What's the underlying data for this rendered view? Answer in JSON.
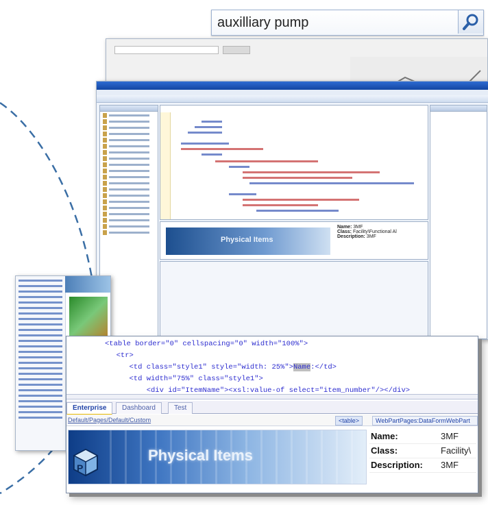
{
  "search": {
    "query": "auxilliary pump",
    "icon": "search-icon"
  },
  "front_screenshot": {
    "code_lines": [
      "<table border=\"0\" cellspacing=\"0\" width=\"100%\">",
      "  <tr>",
      "     <td class=\"style1\" style=\"width: 25%\">Name:</td>",
      "     <td width=\"75%\" class=\"style1\">",
      "         <div id=\"ItemName\"><xsl:value-of select=\"item_number\"/></div>"
    ],
    "tabs": [
      "Enterprise",
      "Dashboard",
      "Test"
    ],
    "breadcrumb": "Default/Pages/Default/Custom",
    "breadcrumb_tag": "<table>",
    "breadcrumb_right": "WebPartPages:DataFormWebPart",
    "banner_title": "Physical Items",
    "banner_icon_letter": "P",
    "properties": [
      {
        "label": "Name:",
        "value": "3MF"
      },
      {
        "label": "Class:",
        "value": "Facility\\"
      },
      {
        "label": "Description:",
        "value": "3MF"
      }
    ]
  },
  "designer_screenshot": {
    "banner_title": "Physical Items",
    "properties": [
      {
        "label": "Name:",
        "value": "3MF"
      },
      {
        "label": "Class:",
        "value": "Facility\\Functional Al"
      },
      {
        "label": "Description:",
        "value": "3MF"
      }
    ]
  },
  "colors": {
    "accent": "#3a6ea5",
    "code": "#2c2ccf",
    "banner": "#1d4f8f"
  }
}
